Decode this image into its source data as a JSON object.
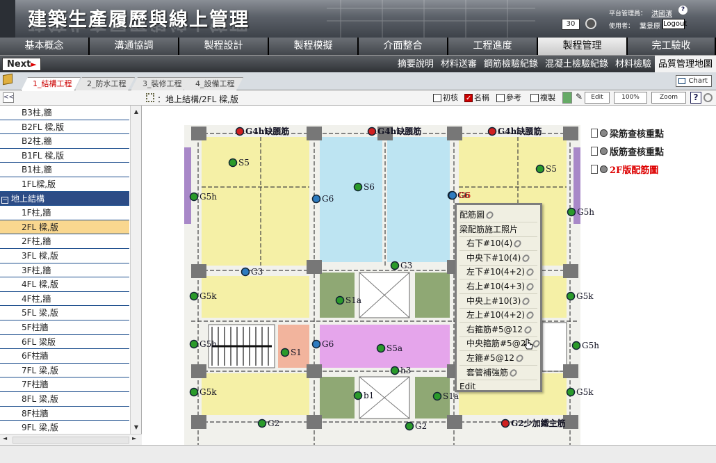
{
  "header": {
    "title": "建築生產履歷與線上管理",
    "zoom_value": "30",
    "admin_label": "平台管理員：",
    "admin_name": "洪國濱",
    "help_glyph": "?",
    "user_label": "使用者：",
    "user_name": "葉景原",
    "logout_label": "Logout"
  },
  "main_nav": {
    "tabs": [
      {
        "label": "基本概念",
        "width": 129
      },
      {
        "label": "溝通協調",
        "width": 129
      },
      {
        "label": "製程設計",
        "width": 129
      },
      {
        "label": "製程模擬",
        "width": 129
      },
      {
        "label": "介面整合",
        "width": 129
      },
      {
        "label": "工程進度",
        "width": 129
      },
      {
        "label": "製程管理",
        "width": 129,
        "active": true
      },
      {
        "label": "完工驗收",
        "width": 127
      }
    ]
  },
  "sub_nav": {
    "next_label": "Next",
    "next_arrow": "►",
    "links": [
      {
        "label": "摘要說明"
      },
      {
        "label": "材料送審"
      },
      {
        "label": "鋼筋檢驗紀錄"
      },
      {
        "label": "混凝土檢驗紀錄"
      },
      {
        "label": "材料檢驗"
      },
      {
        "label": "品質管理地圖",
        "active": true
      }
    ]
  },
  "project_tabs": [
    {
      "label": "1_結構工程",
      "active": true
    },
    {
      "label": "2_防水工程"
    },
    {
      "label": "3_裝修工程"
    },
    {
      "label": "4_設備工程"
    }
  ],
  "chart_button": "Chart",
  "toolbar": {
    "collapse_glyph": "<<",
    "path": "：地上結構/2FL 樑,版",
    "checks": [
      {
        "label": "初核",
        "checked": false
      },
      {
        "label": "名稱",
        "checked": true
      },
      {
        "label": "參考",
        "checked": false
      },
      {
        "label": "複製",
        "checked": false
      }
    ],
    "edit_label": "Edit",
    "zoom_percent": "100%",
    "zoom_label": "Zoom",
    "help_glyph": "?"
  },
  "sidebar": {
    "items": [
      {
        "label": "B3柱,牆"
      },
      {
        "label": "B2FL 樑,版"
      },
      {
        "label": "B2柱,牆"
      },
      {
        "label": "B1FL 樑,版"
      },
      {
        "label": "B1柱,牆"
      },
      {
        "label": "1FL樑,版"
      },
      {
        "label": "地上結構",
        "group": true,
        "expander": "−"
      },
      {
        "label": "1F柱,牆"
      },
      {
        "label": "2FL 樑,版",
        "selected": true
      },
      {
        "label": "2F柱,牆"
      },
      {
        "label": "3FL 樑,版"
      },
      {
        "label": "3F柱,牆"
      },
      {
        "label": "4FL 樑,版"
      },
      {
        "label": "4F柱,牆"
      },
      {
        "label": "5FL 梁,版"
      },
      {
        "label": "5F柱牆"
      },
      {
        "label": "6FL 梁版"
      },
      {
        "label": "6F柱牆"
      },
      {
        "label": "7FL 梁,版"
      },
      {
        "label": "7F柱牆"
      },
      {
        "label": "8FL 梁,版"
      },
      {
        "label": "8F柱牆"
      },
      {
        "label": "9FL 梁,版"
      }
    ],
    "scroll_up": "▲",
    "scroll_down": "▼",
    "scroll_left": "◄",
    "scroll_right": "►"
  },
  "legend": [
    {
      "label": "梁筋查核重點",
      "red": false
    },
    {
      "label": "版筋查核重點",
      "red": false
    },
    {
      "label": "2F版配筋圖",
      "red": true
    }
  ],
  "plan_markers": [
    {
      "label": "G4h缺腰筋",
      "color": "red",
      "bold": true
    },
    {
      "label": "G4h缺腰筋",
      "color": "red",
      "bold": true
    },
    {
      "label": "G4h缺腰筋",
      "color": "red",
      "bold": true
    },
    {
      "label": "S5",
      "color": "green"
    },
    {
      "label": "S5",
      "color": "green"
    },
    {
      "label": "S6",
      "color": "green"
    },
    {
      "label": "G5h",
      "color": "green"
    },
    {
      "label": "G6",
      "color": "blue"
    },
    {
      "label": "G6",
      "color": "blue"
    },
    {
      "label": "G5h",
      "color": "green"
    },
    {
      "label": "G3",
      "color": "green"
    },
    {
      "label": "G3",
      "color": "blue"
    },
    {
      "label": "G5k",
      "color": "green"
    },
    {
      "label": "S1a",
      "color": "green"
    },
    {
      "label": "G5k",
      "color": "green"
    },
    {
      "label": "G5h",
      "color": "green"
    },
    {
      "label": "G6",
      "color": "blue"
    },
    {
      "label": "S5a",
      "color": "green"
    },
    {
      "label": "S1",
      "color": "green"
    },
    {
      "label": "G5h",
      "color": "green"
    },
    {
      "label": "h3",
      "color": "green"
    },
    {
      "label": "G5k",
      "color": "green"
    },
    {
      "label": "b1",
      "color": "green"
    },
    {
      "label": "S1a",
      "color": "green"
    },
    {
      "label": "G5k",
      "color": "green"
    },
    {
      "label": "G2",
      "color": "green"
    },
    {
      "label": "G2",
      "color": "green"
    },
    {
      "label": "G2少加鐵主筋",
      "color": "red",
      "bold": true
    },
    {
      "label": "G6",
      "color": "red",
      "red_text": true
    }
  ],
  "popup": {
    "items": [
      {
        "label": "配筋圖",
        "clip": true,
        "indent": false
      },
      {
        "label": "梁配筋施工照片",
        "clip": false,
        "indent": false
      },
      {
        "label": "右下#10(4)",
        "clip": true,
        "indent": true
      },
      {
        "label": "中央下#10(4)",
        "clip": true,
        "indent": true
      },
      {
        "label": "左下#10(4+2)",
        "clip": true,
        "indent": true
      },
      {
        "label": "右上#10(4+3)",
        "clip": true,
        "indent": true
      },
      {
        "label": "中央上#10(3)",
        "clip": true,
        "indent": true
      },
      {
        "label": "左上#10(4+2)",
        "clip": true,
        "indent": true
      },
      {
        "label": "右箍筋#5@12",
        "clip": true,
        "indent": true
      },
      {
        "label": "中央箍筋#5@25",
        "clip": true,
        "indent": true
      },
      {
        "label": "左箍#5@12",
        "clip": true,
        "indent": true
      },
      {
        "label": "套管補強筋",
        "clip": true,
        "indent": true
      },
      {
        "label": "Edit",
        "clip": false,
        "indent": false
      }
    ]
  },
  "colors": {
    "accent_red": "#d00000",
    "sidebar_group": "#2c4c86",
    "sidebar_selected": "#f9d78f",
    "slab_yellow": "#f5f0a6",
    "slab_blue": "#bde4f2",
    "slab_green": "#8fa874",
    "slab_purple": "#e5a5eb",
    "slab_salmon": "#f2b49d"
  }
}
